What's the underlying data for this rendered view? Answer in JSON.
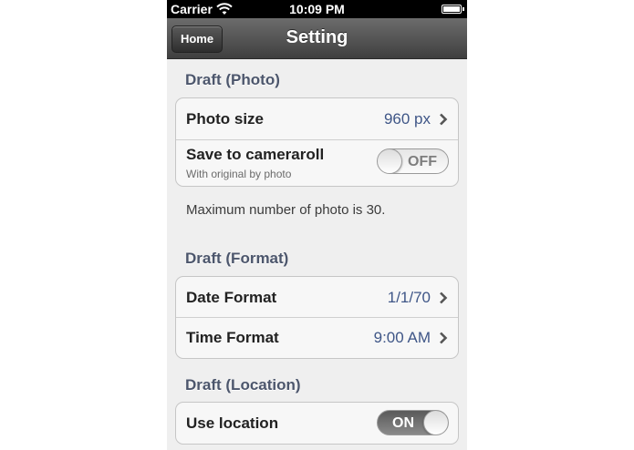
{
  "status_bar": {
    "carrier": "Carrier",
    "time": "10:09 PM",
    "wifi_icon": "wifi-icon",
    "battery_icon": "battery-icon"
  },
  "nav_bar": {
    "title": "Setting",
    "home_label": "Home"
  },
  "sections": {
    "photo": {
      "header": "Draft (Photo)",
      "photo_size": {
        "label": "Photo size",
        "value": "960 px"
      },
      "save_to_cameraroll": {
        "label": "Save to cameraroll",
        "sublabel": "With original by photo",
        "state": "OFF"
      },
      "footer": "Maximum number of photo is 30."
    },
    "format": {
      "header": "Draft (Format)",
      "date_format": {
        "label": "Date Format",
        "value": "1/1/70"
      },
      "time_format": {
        "label": "Time Format",
        "value": "9:00 AM"
      }
    },
    "location": {
      "header": "Draft (Location)",
      "use_location": {
        "label": "Use location",
        "state": "ON"
      }
    }
  },
  "colors": {
    "section_header": "#4c566c",
    "detail_value": "#3f5687",
    "nav_bar": "#4f4f4f",
    "background": "#efefef"
  }
}
